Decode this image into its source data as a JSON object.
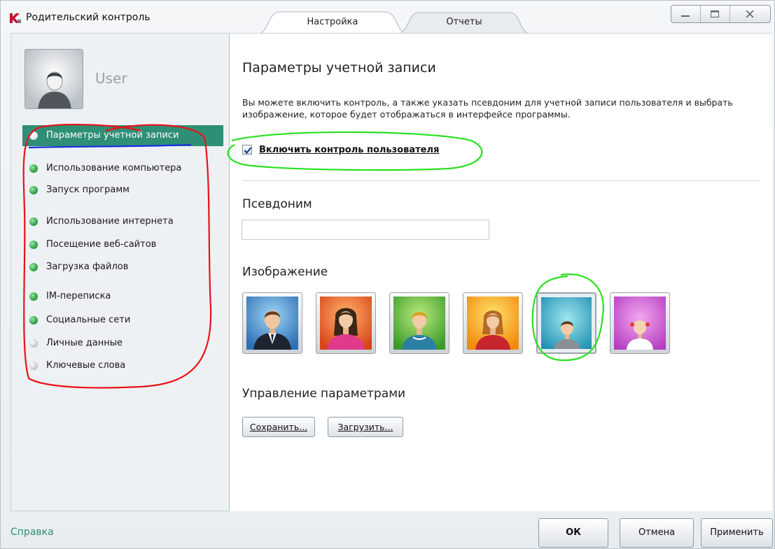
{
  "window": {
    "title": "Родительский контроль",
    "tabs": [
      {
        "label": "Настройка",
        "active": true
      },
      {
        "label": "Отчеты",
        "active": false
      }
    ]
  },
  "sidebar": {
    "user_name": "User",
    "items": [
      {
        "label": "Параметры учетной записи",
        "active": true,
        "dot": "white"
      },
      {
        "label": "Использование компьютера",
        "dot": "green"
      },
      {
        "label": "Запуск программ",
        "dot": "green"
      },
      {
        "label": "Использование интернета",
        "dot": "green"
      },
      {
        "label": "Посещение веб-сайтов",
        "dot": "green"
      },
      {
        "label": "Загрузка файлов",
        "dot": "green"
      },
      {
        "label": "IM-переписка",
        "dot": "green"
      },
      {
        "label": "Социальные сети",
        "dot": "green"
      },
      {
        "label": "Личные данные",
        "dot": "gray"
      },
      {
        "label": "Ключевые слова",
        "dot": "gray"
      }
    ]
  },
  "main": {
    "title": "Параметры учетной записи",
    "description": "Вы можете включить контроль, а также указать псевдоним для учетной записи пользователя и выбрать изображение, которое будет отображаться в интерфейсе программы.",
    "enable_control": {
      "label": "Включить контроль пользователя",
      "checked": true
    },
    "alias": {
      "label": "Псевдоним",
      "value": ""
    },
    "image": {
      "label": "Изображение",
      "selected_index": 4
    },
    "manage": {
      "label": "Управление параметрами",
      "save_label": "Сохранить...",
      "load_label": "Загрузить..."
    }
  },
  "footer": {
    "help_label": "Справка",
    "ok_label": "ОК",
    "cancel_label": "Отмена",
    "apply_label": "Применить"
  },
  "colors": {
    "accent": "#2f8f76",
    "annotation_red": "#e8131a",
    "annotation_green": "#27e11f",
    "annotation_blue": "#1a2fe0"
  },
  "icons": {
    "app": "kaspersky-k-icon",
    "minimize": "minimize-icon",
    "maximize": "maximize-icon",
    "close": "close-icon"
  }
}
